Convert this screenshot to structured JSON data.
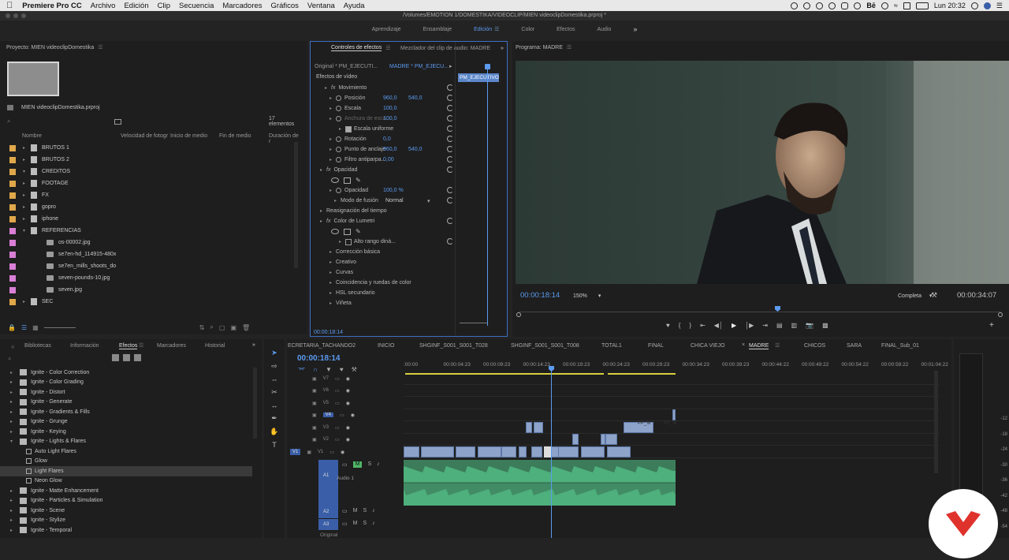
{
  "menubar": {
    "app": "Premiere Pro CC",
    "items": [
      "Archivo",
      "Edición",
      "Clip",
      "Secuencia",
      "Marcadores",
      "Gráficos",
      "Ventana",
      "Ayuda"
    ],
    "clock": "Lun 20:32",
    "be": "Bē"
  },
  "titlebar": {
    "path": "/Volumes/EMOTION 1/DOMESTIKA/VIDEOCLIP/MIEN videoclipDomestika.prproj *"
  },
  "workspaces": {
    "items": [
      "Aprendizaje",
      "Ensamblaje",
      "Edición",
      "Color",
      "Efectos",
      "Audio"
    ],
    "more": "»"
  },
  "project": {
    "title": "Proyecto: MIEN videoclipDomestika",
    "filename": "MIEN videoclipDomestika.prproj",
    "count": "17 elementos",
    "columns": [
      "Nombre",
      "Velocidad de fotogr",
      "Inicio de medio",
      "Fin de medio",
      "Duración de r"
    ],
    "items": [
      {
        "label": "BRUTOS 1",
        "color": "#e0a84a",
        "type": "folder"
      },
      {
        "label": "BRUTOS 2",
        "color": "#e0a84a",
        "type": "folder"
      },
      {
        "label": "CREDITOS",
        "color": "#e0a84a",
        "type": "folder",
        "open": true
      },
      {
        "label": "FOOTAGE",
        "color": "#e0a84a",
        "type": "folder"
      },
      {
        "label": "FX",
        "color": "#e0a84a",
        "type": "folder"
      },
      {
        "label": "gopro",
        "color": "#e0a84a",
        "type": "folder"
      },
      {
        "label": "iphone",
        "color": "#e0a84a",
        "type": "folder"
      },
      {
        "label": "REFERENCIAS",
        "color": "#d97fd6",
        "type": "folder",
        "open": true
      },
      {
        "label": "os-00002.jpg",
        "color": "#d97fd6",
        "type": "file"
      },
      {
        "label": "se7en-hd_114915-480x",
        "color": "#d97fd6",
        "type": "file"
      },
      {
        "label": "se7en_mills_shoots_do",
        "color": "#d97fd6",
        "type": "file"
      },
      {
        "label": "seven-pounds-10.jpg",
        "color": "#d97fd6",
        "type": "file"
      },
      {
        "label": "seven.jpg",
        "color": "#d97fd6",
        "type": "file"
      },
      {
        "label": "SEC",
        "color": "#e0a84a",
        "type": "folder"
      }
    ]
  },
  "effect_controls": {
    "tab1": "Controles de efectos",
    "tab2": "Mezclador del clip de audio: MADRE",
    "source": "Original * PM_EJECUTI...",
    "target": "MADRE * PM_EJECU...",
    "clipname": "PM_EJECUTIVO",
    "section": "Efectos de vídeo",
    "timecode": "00:00:18:14",
    "rows": [
      {
        "label": "Movimiento",
        "indent": 2,
        "fx": true
      },
      {
        "label": "Posición",
        "v1": "960,0",
        "v2": "540,0",
        "indent": 3
      },
      {
        "label": "Escala",
        "v1": "100,0",
        "indent": 3
      },
      {
        "label": "Anchura de esca...",
        "v1": "100,0",
        "indent": 3,
        "dim": true
      },
      {
        "label": "Escala uniforme",
        "indent": 5,
        "check": true
      },
      {
        "label": "Rotación",
        "v1": "0,0",
        "indent": 3
      },
      {
        "label": "Punto de anclaje",
        "v1": "960,0",
        "v2": "540,0",
        "indent": 3
      },
      {
        "label": "Filtro antiparpa...",
        "v1": "0,00",
        "indent": 3
      },
      {
        "label": "Opacidad",
        "indent": 1,
        "fx": true
      },
      {
        "label": "",
        "shapes": true,
        "indent": 3
      },
      {
        "label": "Opacidad",
        "v1": "100,0 %",
        "indent": 3
      },
      {
        "label": "Modo de fusión",
        "v1": "Normal",
        "indent": 4,
        "select": true
      },
      {
        "label": "Reasignación del tiempo",
        "indent": 1
      },
      {
        "label": "Color de Lumetri",
        "indent": 1,
        "fx": true
      },
      {
        "label": "",
        "shapes": true,
        "indent": 3
      },
      {
        "label": "Alto rango diná...",
        "indent": 5,
        "check": false
      },
      {
        "label": "Corrección básica",
        "indent": 3
      },
      {
        "label": "Creativo",
        "indent": 3
      },
      {
        "label": "Curvas",
        "indent": 3
      },
      {
        "label": "Coincidencia y ruedas de color",
        "indent": 3
      },
      {
        "label": "HSL secundario",
        "indent": 3
      },
      {
        "label": "Viñeta",
        "indent": 3
      }
    ]
  },
  "program": {
    "title": "Programa: MADRE",
    "timecode": "00:00:18:14",
    "zoom": "150%",
    "quality": "Completa",
    "duration": "00:00:34:07"
  },
  "effects_panel": {
    "tabs": [
      "Bibliotecas",
      "Información",
      "Efectos",
      "Marcadores",
      "Historial"
    ],
    "active": "Efectos",
    "items": [
      {
        "label": "Ignite - Color Correction",
        "level": 0
      },
      {
        "label": "Ignite - Color Grading",
        "level": 0
      },
      {
        "label": "Ignite - Distort",
        "level": 0
      },
      {
        "label": "Ignite - Generate",
        "level": 0
      },
      {
        "label": "Ignite - Gradients & Fills",
        "level": 0
      },
      {
        "label": "Ignite - Grunge",
        "level": 0
      },
      {
        "label": "Ignite - Keying",
        "level": 0
      },
      {
        "label": "Ignite - Lights & Flares",
        "level": 0,
        "open": true
      },
      {
        "label": "Auto Light Flares",
        "level": 1
      },
      {
        "label": "Glow",
        "level": 1
      },
      {
        "label": "Light Flares",
        "level": 1,
        "selected": true
      },
      {
        "label": "Neon Glow",
        "level": 1
      },
      {
        "label": "Ignite - Matte Enhancement",
        "level": 0
      },
      {
        "label": "Ignite - Particles & Simulation",
        "level": 0
      },
      {
        "label": "Ignite - Scene",
        "level": 0
      },
      {
        "label": "Ignite - Stylize",
        "level": 0
      },
      {
        "label": "Ignite - Temporal",
        "level": 0
      }
    ]
  },
  "timeline": {
    "tabs": [
      "ECRETARIA_TACHANDO2",
      "INICIO",
      "SHGINF_S001_S001_T028",
      "SHGINF_S001_S001_T008",
      "TOTAL1",
      "FINAL",
      "CHICA VIEJO",
      "MADRE",
      "CHICOS",
      "SARA",
      "FINAL_Sub_01"
    ],
    "active": "MADRE",
    "timecode": "00:00:18:14",
    "ruler": [
      ":00:00",
      "00:00:04:23",
      "00:00:09:23",
      "00:00:14:23",
      "00:00:19:23",
      "00:00:24:23",
      "00:00:29:23",
      "00:00:34:23",
      "00:00:39:23",
      "00:00:44:22",
      "00:00:49:22",
      "00:00:54:22",
      "00:00:59:22",
      "00:01:04:22"
    ],
    "video_tracks": [
      "V7",
      "V6",
      "V5",
      "V4",
      "V3",
      "V2",
      "V1"
    ],
    "audio_tracks": [
      "A1",
      "A2",
      "A3"
    ],
    "audio_label": "Audio 1",
    "original": "Original",
    "clip_label": "PP_M",
    "clip_label2": "PP_M"
  },
  "meters": [
    "-12",
    "-18",
    "-24",
    "-30",
    "-36",
    "-42",
    "-48",
    "-54"
  ]
}
